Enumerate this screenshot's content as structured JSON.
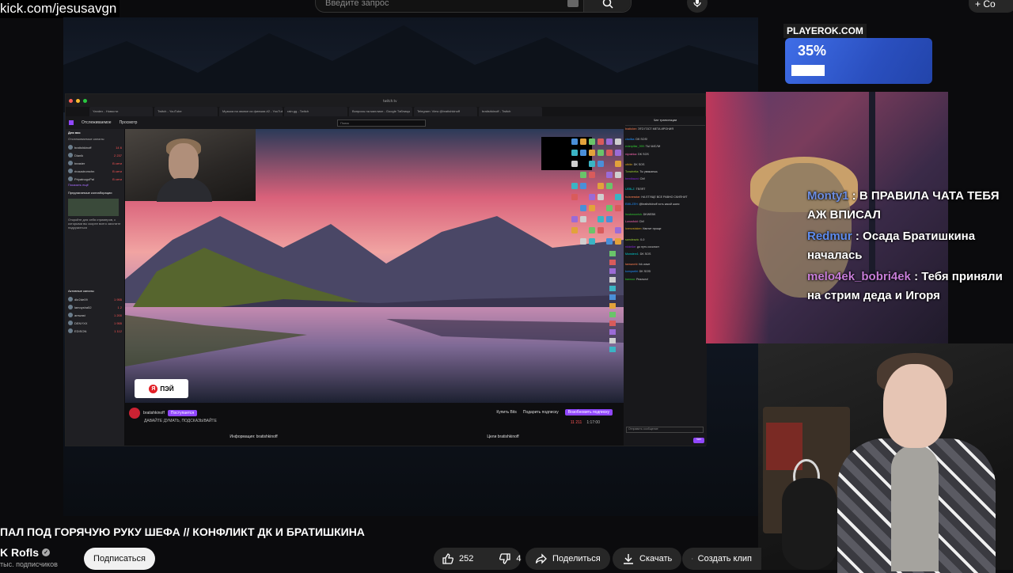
{
  "header": {
    "kick_url": "kick.com/jesusavgn",
    "search_placeholder": "Введите запрос",
    "create_label": "+ Со"
  },
  "twitch_window": {
    "tabs": [
      "Yandex - Новости",
      "Twitch - YouTube",
      "Музыка на звонке из фильма #2 - YouTube",
      "rain.gg - Twitch",
      "Вопросы на миллион - Google Таблицы",
      "Telegram: View @bratishkinoff",
      "bratishkinoff - Twitch"
    ],
    "url": "twitch.tv",
    "nav_following": "Отслеживаемое",
    "nav_browse": "Просмотр",
    "search_placeholder": "Поиск",
    "left_header": "Для вас",
    "left_sub": "Отслеживаемые каналы",
    "left_channels": [
      {
        "name": "bratishkinoff",
        "viewers": "14 6"
      },
      {
        "name": "Dianik",
        "viewers": "2 237"
      },
      {
        "name": "beaster",
        "viewers": "В сети"
      },
      {
        "name": "rinaustromchn",
        "viewers": "В сети"
      },
      {
        "name": "PriyatnogoPal",
        "viewers": "В сети"
      }
    ],
    "left_more": "Показать ещё",
    "collab_title": "Предлагаемые коллаборации",
    "collab_text": "Откройте для себя стримеров, с которыми вы скорее всего захотите подружиться",
    "active_title": "Активные каналы",
    "active_channels": [
      {
        "name": "dkr2de09",
        "viewers": "1 955"
      },
      {
        "name": "lamoysha52",
        "viewers": "1 2"
      },
      {
        "name": "amwast",
        "viewers": "1 200"
      },
      {
        "name": "DENYXX",
        "viewers": "1 955"
      },
      {
        "name": "EDISON",
        "viewers": "1 112"
      }
    ],
    "ad_label": "ПЭЙ",
    "streamer_name": "bratishkinoff",
    "subscribe_btn": "Поступается",
    "stream_title": "ДАВАЙТЕ ДУМАТЬ, ПОДСКАЗЫВАЙТЕ",
    "buy_label": "Купить Bits",
    "gift_label": "Подарить подписку",
    "sub_label": "Возобновить подписку",
    "viewer_count": "11 211",
    "uptime": "1:17:00",
    "info_label": "Информация: bratishkinoff",
    "goals_label": "Цели bratishkinoff",
    "chat_header": "Чат трансляции",
    "chat_lines": [
      "bratisher: ЭТО ГОСТ МЕТА ИРОНИЯ",
      "ctadika: DK SOS!",
      "exterpillar_999: ТЫ ЧИСЛИ",
      "niyoshka: DK SOS",
      "otbite: DK SOS",
      "Tonwiretta: Ты уважаешь",
      "bemibaoni: Chi!",
      "UEBLZ: ТЕЛЯТ",
      "buisnesstar: НА ЕГУЩЕ ВСЕ РАВНО СКИПНИТ",
      "EMILZEH: @bratishkinoff хоть какой шанс",
      "Irustoroonish: DKWEBK",
      "Lunusfold: Chi!",
      "lorenzstaken: Квитит проще",
      "samdeavic: 0-0",
      "nicknike: до путь соскочит",
      "Monsterv1: DK SOS",
      "tansworld: fck wave",
      "kompartiri: DK SOS!",
      "bannoo: Реально!"
    ],
    "chat_send_placeholder": "Отправить сообщение",
    "chat_button": "Чат"
  },
  "right_side": {
    "promo_title": "PLAYEROK.COM",
    "promo_discount": "35%",
    "overlay_messages": [
      {
        "user": "Monty1",
        "text": "В ПРАВИЛА ЧАТА ТЕБЯ АЖ ВПИСАЛ"
      },
      {
        "user": "Redmur",
        "text": "Осада Братишкина началась"
      },
      {
        "user": "melo4ek_bobri4ek",
        "text": "Тебя приняли на стрим деда и Игоря"
      }
    ]
  },
  "video": {
    "title": "ПАЛ ПОД ГОРЯЧУЮ РУКУ ШЕФА // КОНФЛИКТ ДК И БРАТИШКИНА",
    "channel": "K Rofls",
    "subscribers": "тыс. подписчиков",
    "subscribe_label": "Подписаться",
    "likes": "252",
    "dislikes": "4",
    "share_label": "Поделиться",
    "download_label": "Скачать",
    "clip_label": "Создать клип"
  },
  "colors": {
    "twitch_purple": "#9147ff",
    "yt_bg": "#0f0f0f",
    "overlay_user1": "#6d8de0",
    "overlay_user3": "#c77dd8"
  }
}
